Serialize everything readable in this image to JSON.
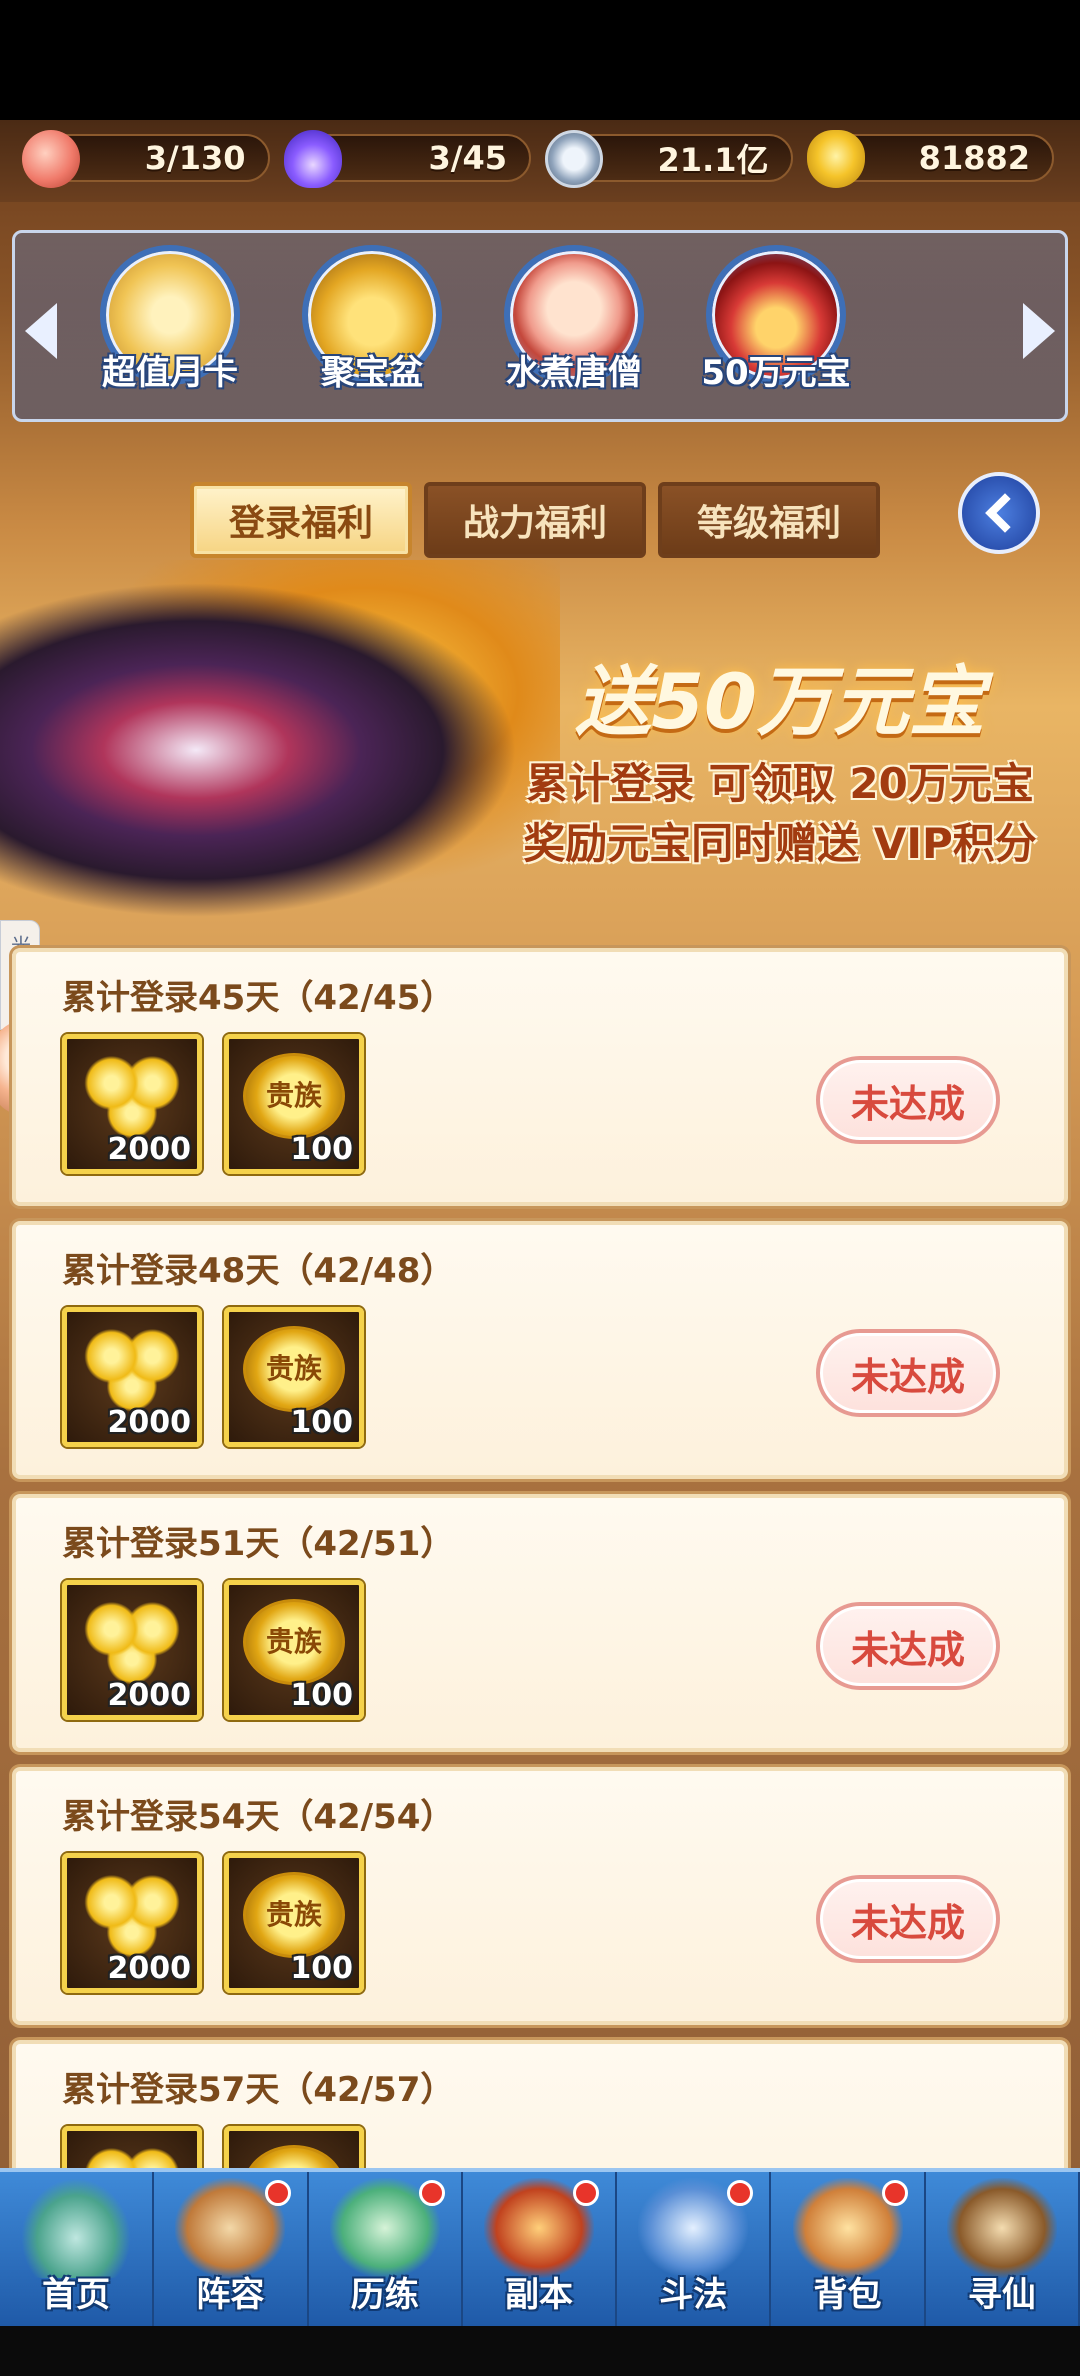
{
  "resources": [
    {
      "icon": "peach-icon",
      "value": "3/130"
    },
    {
      "icon": "flame-icon",
      "value": "3/45"
    },
    {
      "icon": "coin-icon",
      "value": "21.1亿"
    },
    {
      "icon": "gold-ingot-icon",
      "value": "81882"
    }
  ],
  "events": [
    {
      "label": "超值月卡",
      "icon": "monthly-card-icon"
    },
    {
      "label": "聚宝盆",
      "icon": "treasure-bowl-icon"
    },
    {
      "label": "水煮唐僧",
      "icon": "monk-icon"
    },
    {
      "label": "50万元宝",
      "icon": "treasure-chest-icon"
    }
  ],
  "tabs": [
    {
      "label": "登录福利",
      "active": true
    },
    {
      "label": "战力福利",
      "active": false
    },
    {
      "label": "等级福利",
      "active": false
    }
  ],
  "banner": {
    "headline": "送50万元宝",
    "line1": "累计登录 可领取 20万元宝",
    "line2": "奖励元宝同时赠送 VIP积分"
  },
  "helper": {
    "label": "光环助手"
  },
  "rewards": [
    {
      "title": "累计登录45天（42/45）",
      "items": [
        {
          "name": "元宝",
          "qty": "2000"
        },
        {
          "name": "贵族",
          "qty": "100"
        }
      ],
      "status": "未达成"
    },
    {
      "title": "累计登录48天（42/48）",
      "items": [
        {
          "name": "元宝",
          "qty": "2000"
        },
        {
          "name": "贵族",
          "qty": "100"
        }
      ],
      "status": "未达成"
    },
    {
      "title": "累计登录51天（42/51）",
      "items": [
        {
          "name": "元宝",
          "qty": "2000"
        },
        {
          "name": "贵族",
          "qty": "100"
        }
      ],
      "status": "未达成"
    },
    {
      "title": "累计登录54天（42/54）",
      "items": [
        {
          "name": "元宝",
          "qty": "2000"
        },
        {
          "name": "贵族",
          "qty": "100"
        }
      ],
      "status": "未达成"
    },
    {
      "title": "累计登录57天（42/57）",
      "items": [
        {
          "name": "元宝",
          "qty": ""
        },
        {
          "name": "贵族",
          "qty": ""
        }
      ],
      "status": ""
    }
  ],
  "nav": [
    {
      "label": "首页",
      "badge": false
    },
    {
      "label": "阵容",
      "badge": true
    },
    {
      "label": "历练",
      "badge": true
    },
    {
      "label": "副本",
      "badge": true
    },
    {
      "label": "斗法",
      "badge": true
    },
    {
      "label": "背包",
      "badge": true
    },
    {
      "label": "寻仙",
      "badge": false
    }
  ],
  "colors": {
    "accent": "#d84a3e",
    "nav": "#1f5aa8",
    "gold": "#f5d24b"
  }
}
